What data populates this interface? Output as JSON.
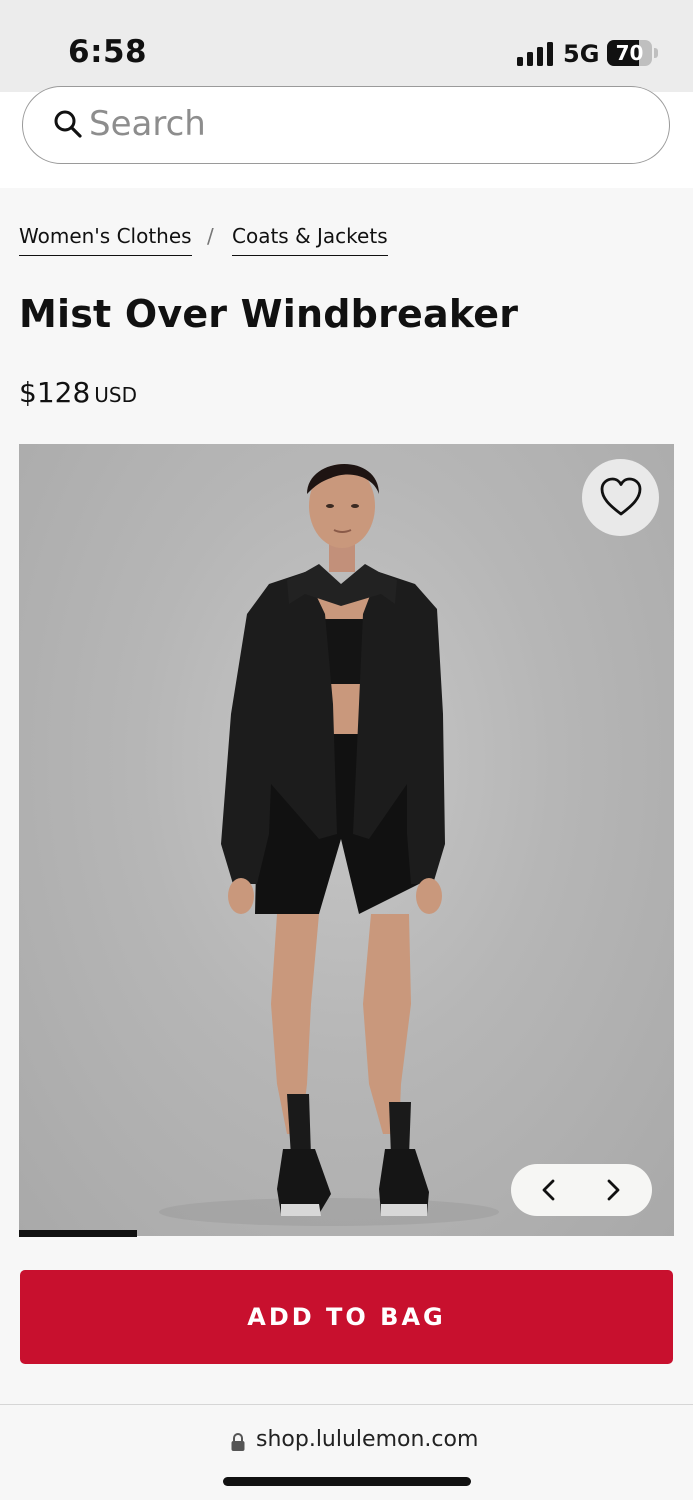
{
  "status_bar": {
    "time": "6:58",
    "network": "5G",
    "battery": "70",
    "battery_level": 0.7,
    "signal_bars": 4
  },
  "search": {
    "placeholder": "Search",
    "icon": "search-icon"
  },
  "breadcrumb": {
    "items": [
      {
        "label": "Women's Clothes"
      },
      {
        "label": "Coats & Jackets"
      }
    ],
    "separator": "/"
  },
  "product": {
    "title": "Mist Over Windbreaker",
    "price": "$128",
    "currency": "USD",
    "wishlist_icon": "heart-icon",
    "carousel": {
      "prev_icon": "chevron-left-icon",
      "next_icon": "chevron-right-icon",
      "progress": 0.18
    }
  },
  "actions": {
    "add_to_bag": "ADD TO BAG"
  },
  "browser": {
    "url": "shop.lululemon.com",
    "lock_icon": "lock-icon"
  },
  "colors": {
    "brand_red": "#c8102e",
    "background": "#f7f7f7",
    "text": "#111111"
  }
}
